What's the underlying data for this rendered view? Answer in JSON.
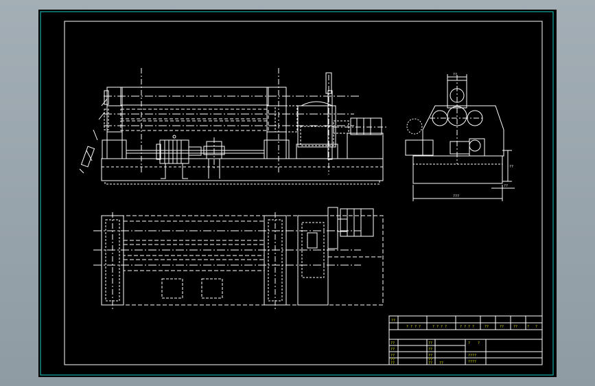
{
  "colors": {
    "background": "#000000",
    "outer_frame": "#18d1c8",
    "drawing": "#ffffff",
    "title_block_text": "#e6e600",
    "viewport_gray": "#9aa6ad"
  },
  "title_block": {
    "header_cells": [
      "??",
      "? ? ? ?",
      "? ? ? ?",
      "? ? ? ?",
      "??",
      "??",
      "??",
      "?",
      "?"
    ],
    "left_rows": [
      "??",
      "??",
      "??",
      "??",
      "??"
    ],
    "mid_rows": [
      "??",
      "??",
      "??",
      "??",
      "??"
    ],
    "mid_extra": "??",
    "name_cells": [
      "?",
      "?",
      "????",
      "????"
    ]
  },
  "dimensions": {
    "side_top": "??",
    "side_height": "??",
    "side_width": "???",
    "side_offset": "??"
  }
}
